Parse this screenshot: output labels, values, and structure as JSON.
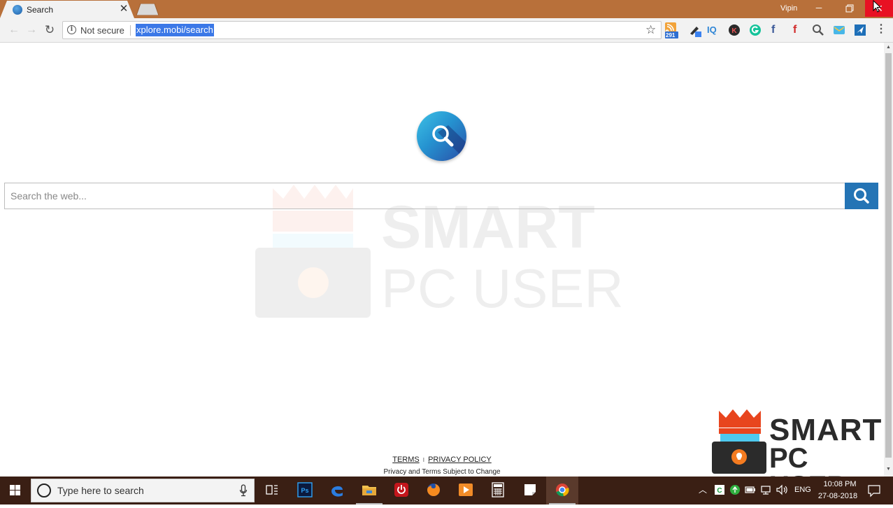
{
  "browser": {
    "tab": {
      "title": "Search",
      "favicon": "globe-search-icon"
    },
    "profile_name": "Vipin",
    "window_controls": {
      "minimize": "─",
      "close": "✕"
    },
    "omnibox": {
      "security_label": "Not secure",
      "url": "xplore.mobi/search"
    },
    "extensions": [
      {
        "name": "rss-feed-extension-icon",
        "badge": "291"
      },
      {
        "name": "eyedropper-extension-icon"
      },
      {
        "name": "iq-extension-icon",
        "text": "IQ"
      },
      {
        "name": "k-extension-icon",
        "text": "K"
      },
      {
        "name": "grammarly-extension-icon"
      },
      {
        "name": "facebook-extension-icon"
      },
      {
        "name": "facebook-red-extension-icon"
      },
      {
        "name": "search-extension-icon"
      },
      {
        "name": "mail-extension-icon"
      },
      {
        "name": "send-extension-icon"
      }
    ]
  },
  "page": {
    "search": {
      "placeholder": "Search the web..."
    },
    "footer": {
      "terms": "TERMS",
      "separator": "I",
      "privacy": "PRIVACY POLICY",
      "note": "Privacy and Terms Subject to Change"
    },
    "watermark": {
      "line1": "SMART",
      "line2": "PC USER"
    }
  },
  "brand_overlay": {
    "line1": "SMART",
    "line2": "PC USER"
  },
  "taskbar": {
    "search_placeholder": "Type here to search",
    "pinned": [
      "task-view-icon",
      "photoshop-icon",
      "edge-icon",
      "file-explorer-icon",
      "power-app-icon",
      "firefox-icon",
      "media-player-icon",
      "calculator-icon",
      "sticky-notes-icon",
      "chrome-icon"
    ],
    "tray": {
      "language": "ENG",
      "time": "10:08 PM",
      "date": "27-08-2018"
    }
  },
  "colors": {
    "titlebar": "#b8703a",
    "selection": "#3b78e7",
    "search_button": "#2474b5",
    "taskbar": "#3a1f14",
    "close_button": "#e81123"
  }
}
